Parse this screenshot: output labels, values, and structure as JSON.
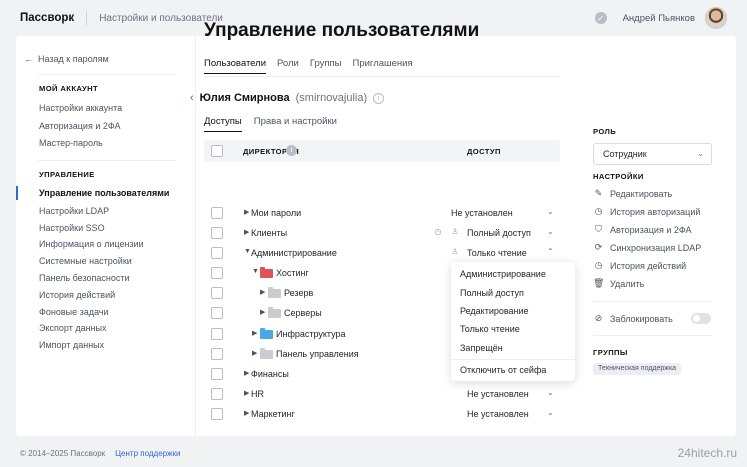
{
  "header": {
    "brand": "Пассворк",
    "section": "Настройки и пользователи",
    "user_name": "Андрей Пьянков"
  },
  "sidebar": {
    "back": "Назад к паролям",
    "account_heading": "МОЙ АККАУНТ",
    "account_items": [
      "Настройки аккаунта",
      "Авторизация и 2ФА",
      "Мастер-пароль"
    ],
    "manage_heading": "УПРАВЛЕНИЕ",
    "manage_items": [
      "Управление пользователями",
      "Настройки LDAP",
      "Настройки SSO",
      "Информация о лицензии",
      "Системные настройки",
      "Панель безопасности",
      "История действий",
      "Фоновые задачи",
      "Экспорт данных",
      "Импорт данных"
    ]
  },
  "main": {
    "title": "Управление пользователями",
    "tabs": [
      "Пользователи",
      "Роли",
      "Группы",
      "Приглашения"
    ],
    "user": {
      "name": "Юлия Смирнова",
      "login": "(smirnovajulia)"
    },
    "subtabs": [
      "Доступы",
      "Права и настройки"
    ],
    "table": {
      "col_directory": "ДИРЕКТОРИЯ",
      "col_access": "ДОСТУП",
      "rows": [
        {
          "label": "Мои пароли",
          "access": "Не установлен"
        },
        {
          "label": "Клиенты",
          "access": "Полный доступ"
        },
        {
          "label": "Администрирование",
          "access": "Только чтение"
        },
        {
          "label": "Хостинг",
          "access": ""
        },
        {
          "label": "Резерв",
          "access": ""
        },
        {
          "label": "Серверы",
          "access": ""
        },
        {
          "label": "Инфраструктура",
          "access": ""
        },
        {
          "label": "Панель управления",
          "access": ""
        },
        {
          "label": "Финансы",
          "access": ""
        },
        {
          "label": "HR",
          "access": "Не установлен"
        },
        {
          "label": "Маркетинг",
          "access": "Не установлен"
        }
      ]
    },
    "access_menu": [
      "Администрирование",
      "Полный доступ",
      "Редактирование",
      "Только чтение",
      "Запрещён",
      "Отключить от сейфа"
    ]
  },
  "right_panel": {
    "role_heading": "РОЛЬ",
    "role_value": "Сотрудник",
    "settings_heading": "НАСТРОЙКИ",
    "actions": [
      "Редактировать",
      "История авторизаций",
      "Авторизация и 2ФА",
      "Синхронизация LDAP",
      "История действий",
      "Удалить"
    ],
    "block_label": "Заблокировать",
    "groups_heading": "ГРУППЫ",
    "group_chip": "Техническая поддержка"
  },
  "footer": {
    "copyright": "© 2014–2025 Пассворк",
    "support": "Центр поддержки"
  },
  "watermark": "24hitech.ru",
  "colors": {
    "accent": "#2f66d9",
    "folder_red": "#e0525a",
    "folder_blue": "#4aa8e8",
    "folder_gray": "#c9cdd2"
  }
}
